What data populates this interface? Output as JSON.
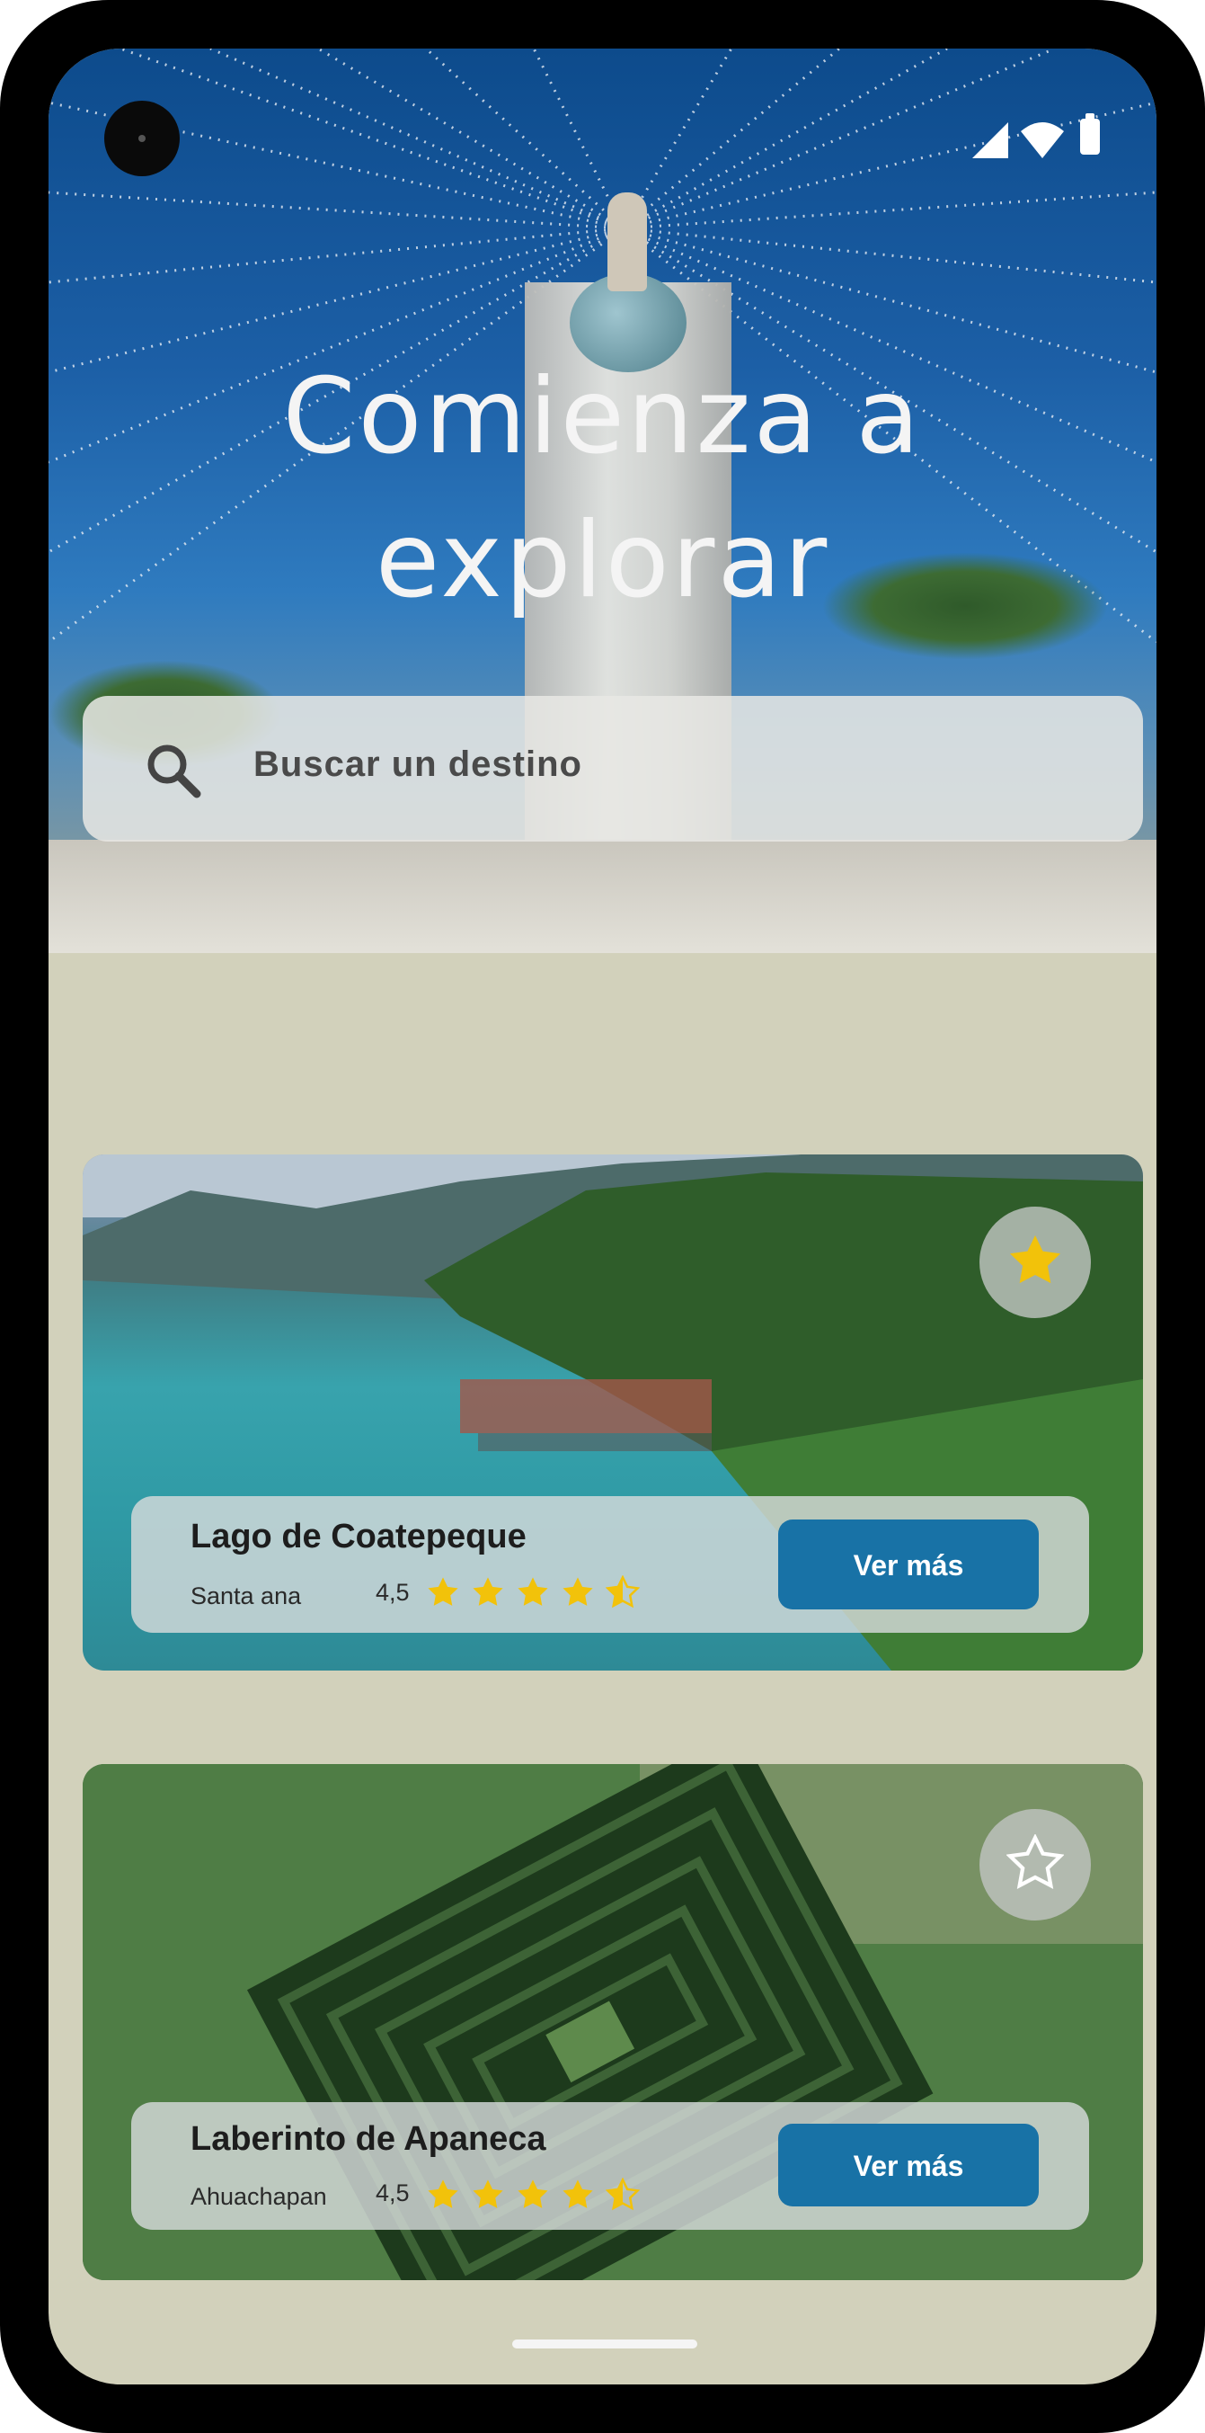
{
  "hero": {
    "title": "Comienza a\nexplorar"
  },
  "search": {
    "placeholder": "Buscar un destino",
    "icon": "search-icon"
  },
  "destinations": [
    {
      "name": "Lago de Coatepeque",
      "region": "Santa ana",
      "rating": "4,5",
      "rating_value": 4.5,
      "favorite": true,
      "button_label": "Ver más"
    },
    {
      "name": "Laberinto de Apaneca",
      "region": "Ahuachapan",
      "rating": "4,5",
      "rating_value": 4.5,
      "favorite": false,
      "button_label": "Ver más"
    }
  ],
  "colors": {
    "accent_button": "#1872a6",
    "star": "#f2c20a",
    "background": "#d2d1bb"
  }
}
